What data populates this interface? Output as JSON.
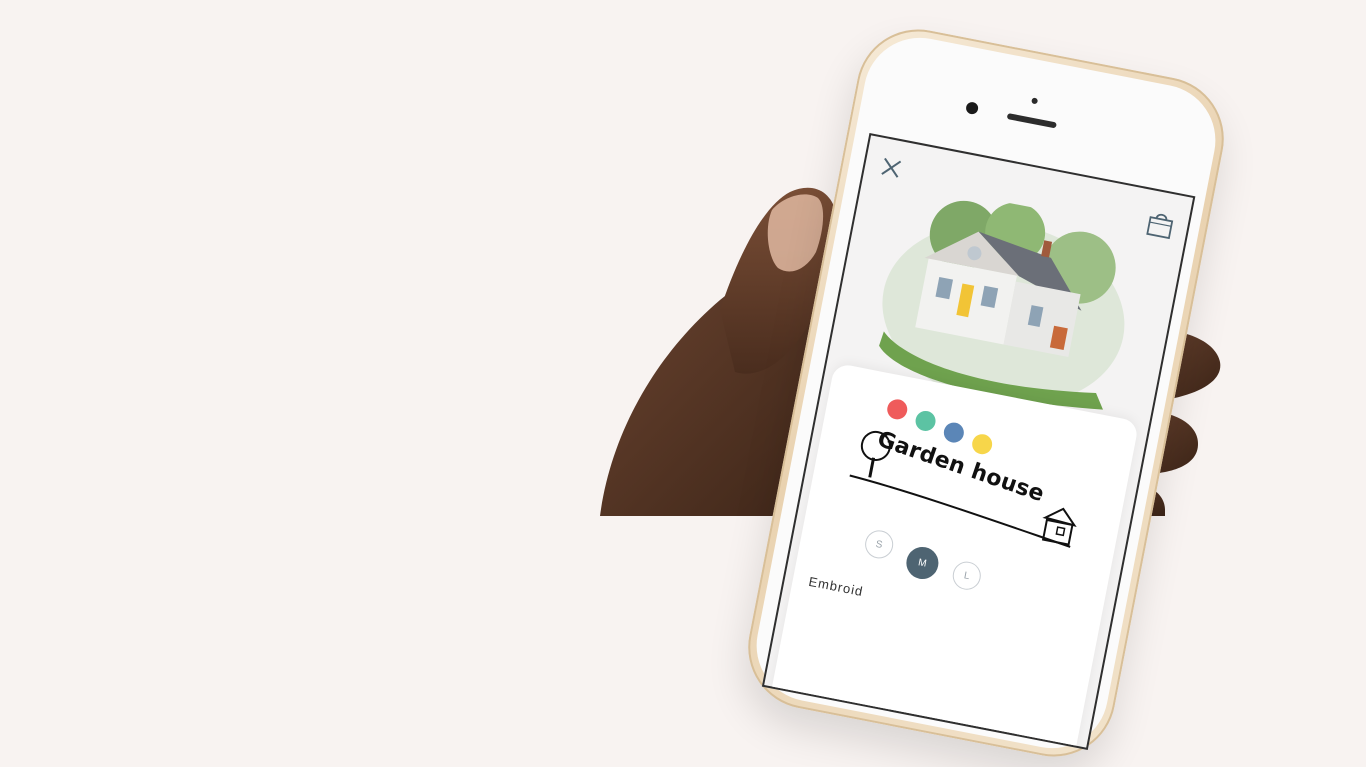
{
  "app": {
    "close_icon": "close-icon",
    "bag_icon": "shopping-bag-icon"
  },
  "product": {
    "image_subject": "white cottage house with yellow door",
    "colors": [
      "#ef5b5b",
      "#5cc3a3",
      "#5b86b7",
      "#f7d64a"
    ],
    "logo_text": "Garden house",
    "sizes": [
      {
        "label": "S",
        "selected": false
      },
      {
        "label": "M",
        "selected": true
      },
      {
        "label": "L",
        "selected": false
      }
    ],
    "embroidery_label": "Embroid"
  },
  "theme": {
    "background": "#f8f3f1",
    "accent": "#4e6472",
    "phone_gold": "#e9d2b0"
  }
}
